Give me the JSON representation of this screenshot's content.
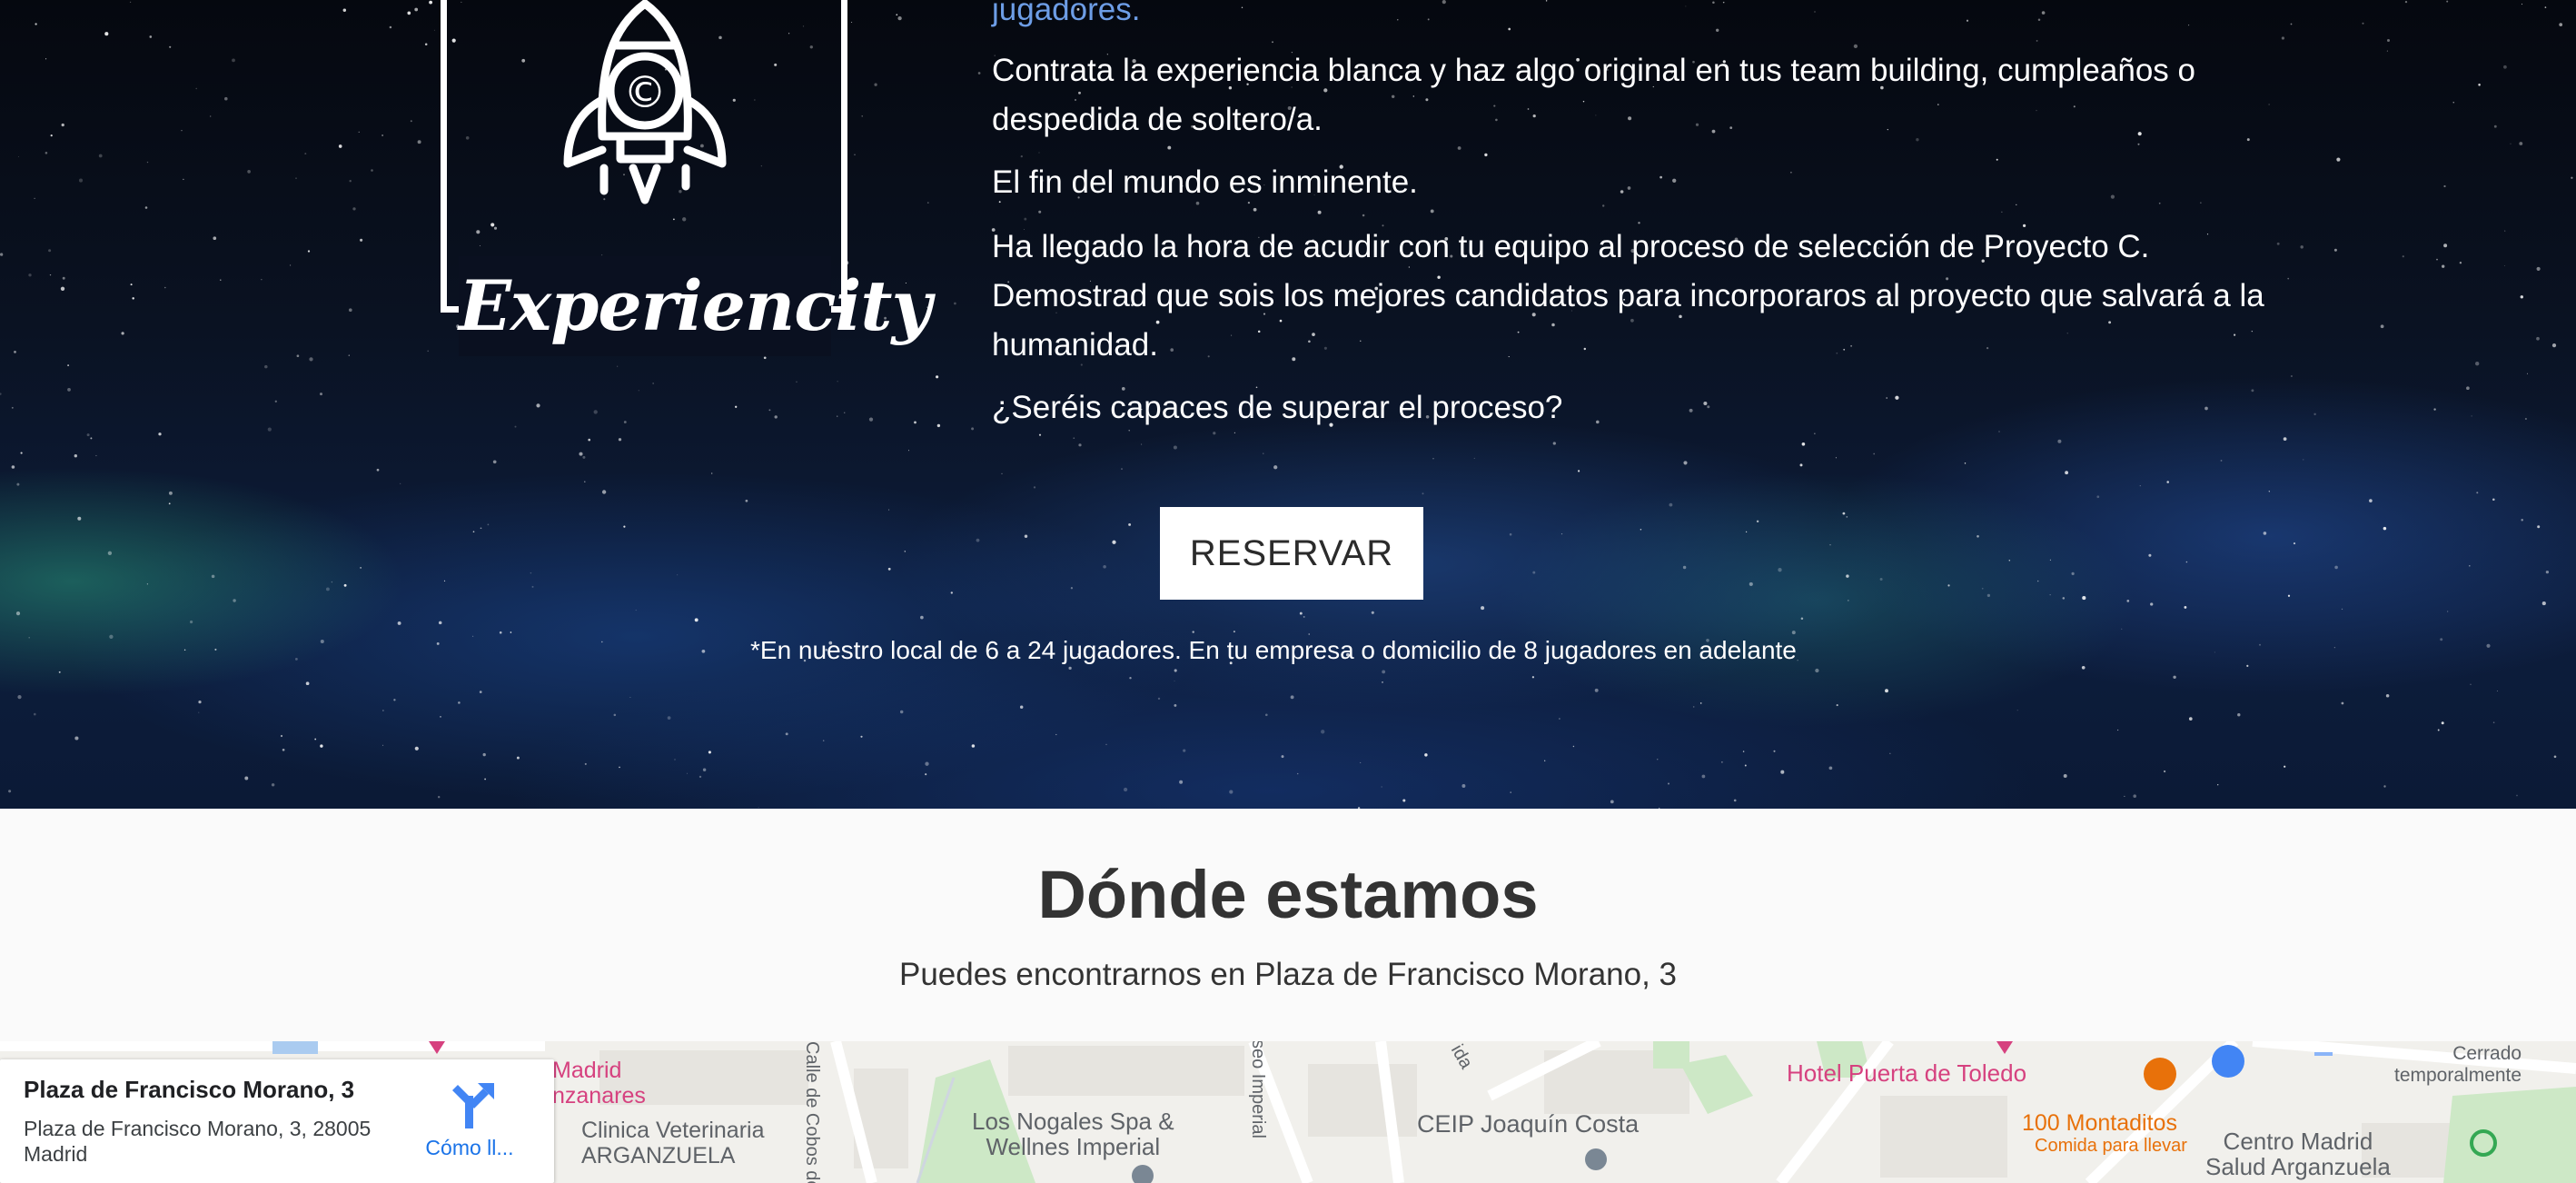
{
  "hero": {
    "link_text": "jugadores.",
    "paragraphs": [
      "Contrata la experiencia blanca y haz algo original en tus team building, cumpleaños o despedida de soltero/a.",
      "El fin del mundo es inminente.",
      "Ha llegado la hora de acudir con tu equipo al proceso de selección de Proyecto C. Demostrad que sois los mejores candidatos para incorporaros al proyecto que salvará a la humanidad.",
      "¿Seréis capaces de superar el proceso?"
    ],
    "reserve_label": "RESERVAR",
    "footnote": "*En nuestro local de 6 a 24 jugadores. En tu empresa o domicilio de 8 jugadores en adelante"
  },
  "logo": {
    "wordmark": "Experiencity",
    "icon": "rocket-icon"
  },
  "where": {
    "title": "Dónde estamos",
    "subtitle": "Puedes encontrarnos en Plaza de Francisco Morano, 3"
  },
  "map": {
    "card": {
      "title": "Plaza de Francisco Morano, 3",
      "address": "Plaza de Francisco Morano, 3, 28005 Madrid",
      "directions_label": "Cómo ll...",
      "directions_icon": "directions-icon"
    },
    "labels": {
      "madrid_manzanares": "Madrid\nnzanares",
      "clinica": "Clinica Veterinaria\nARGANZUELA",
      "calle_cobos": "Calle de Cobos de",
      "nogales": "Los Nogales Spa &\nWellnes Imperial",
      "paseo_imperial": "seo Imperial",
      "ida": "ida",
      "ceip": "CEIP Joaquín Costa",
      "hotel": "Hotel Puerta de Toledo",
      "montaditos": "100 Montaditos",
      "montaditos_sub": "Comida para llevar",
      "cerrado": "Cerrado\ntemporalmente",
      "centro": "Centro Madrid\nSalud Arganzuela"
    },
    "colors": {
      "pink_poi": "#d6417f",
      "orange_poi": "#e8710a",
      "blue_poi": "#4285f4",
      "park": "#c8e6c9"
    }
  }
}
